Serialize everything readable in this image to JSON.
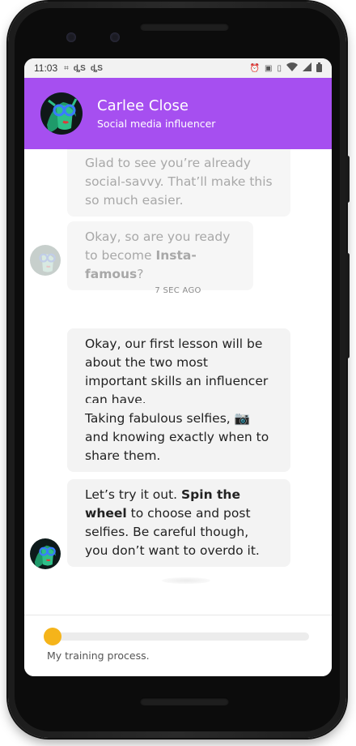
{
  "status_bar": {
    "time": "11:03",
    "icons_left": [
      "network-icon",
      "data-icon",
      "data-icon"
    ],
    "icons_right": [
      "alarm-icon",
      "cast-icon",
      "vibrate-icon",
      "wifi-icon",
      "signal-icon",
      "battery-icon"
    ]
  },
  "header": {
    "name": "Carlee Close",
    "role": "Social media influencer",
    "background_color": "#a64ff0"
  },
  "messages": [
    {
      "text": "Glad to see you’re already social-savvy. That’ll make this so much easier.",
      "faded": true
    },
    {
      "text_before": "Okay, so are you ready to become ",
      "bold": "Insta-famous",
      "text_after": "?",
      "faded": true
    },
    {
      "text": "Okay, our first lesson will be about the two most important skills an influencer can have.",
      "faded": false
    },
    {
      "text": "Taking fabulous selfies, 📷 and knowing exactly when to share them.",
      "faded": false
    },
    {
      "text_before": "Let’s try it out. ",
      "bold": "Spin the wheel",
      "text_after": " to choose and post selfies. Be careful though, you don’t want to overdo it.",
      "faded": false
    }
  ],
  "timestamp": "7 SEC AGO",
  "footer": {
    "progress_fraction": 0.0,
    "label": "My training process.",
    "knob_color": "#f5b41a"
  }
}
